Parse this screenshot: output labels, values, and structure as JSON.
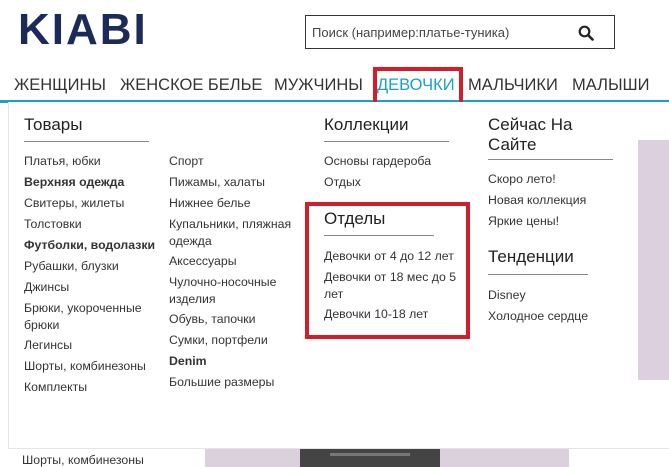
{
  "header": {
    "logo": "KIABI",
    "search_placeholder": "Поиск (например:платье-туника)"
  },
  "nav": {
    "items": [
      "ЖЕНЩИНЫ",
      "ЖЕНСКОЕ БЕЛЬЕ",
      "МУЖЧИНЫ",
      "ДЕВОЧКИ",
      "МАЛЬЧИКИ",
      "МАЛЫШИ"
    ],
    "active": "ДЕВОЧКИ"
  },
  "menu": {
    "products": {
      "title": "Товары",
      "col1": [
        "Платья, юбки",
        "Верхняя одежда",
        "Свитеры, жилеты",
        "Толстовки",
        "Футболки, водолазки",
        "Рубашки, блузки",
        "Джинсы",
        "Брюки, укороченные брюки",
        "Легинсы",
        "Шорты, комбинезоны",
        "Комплекты"
      ],
      "col2": [
        "Спорт",
        "Пижамы, халаты",
        "Нижнее белье",
        "Купальники, пляжная одежда",
        "Аксессуары",
        "Чулочно-носочные изделия",
        "Обувь, тапочки",
        "Сумки, портфели",
        "Denim",
        "Большие размеры"
      ]
    },
    "collections": {
      "title": "Коллекции",
      "items": [
        "Основы гардероба",
        "Отдых"
      ]
    },
    "departments": {
      "title": "Отделы",
      "items": [
        "Девочки от 4 до 12 лет",
        "Девочки от 18 мес до 5 лет",
        "Девочки 10-18 лет"
      ]
    },
    "now": {
      "title": "Сейчас На Сайте",
      "items": [
        "Скоро лето!",
        "Новая коллекция",
        "Яркие цены!"
      ]
    },
    "trends": {
      "title": "Тенденции",
      "items": [
        "Disney",
        "Холодное сердце"
      ]
    }
  },
  "background": {
    "partial_text": "Шорты, комбинезоны"
  },
  "colors": {
    "brand": "#1c2a5a",
    "accent": "#1aa0c8",
    "highlight": "#d11e2a"
  }
}
